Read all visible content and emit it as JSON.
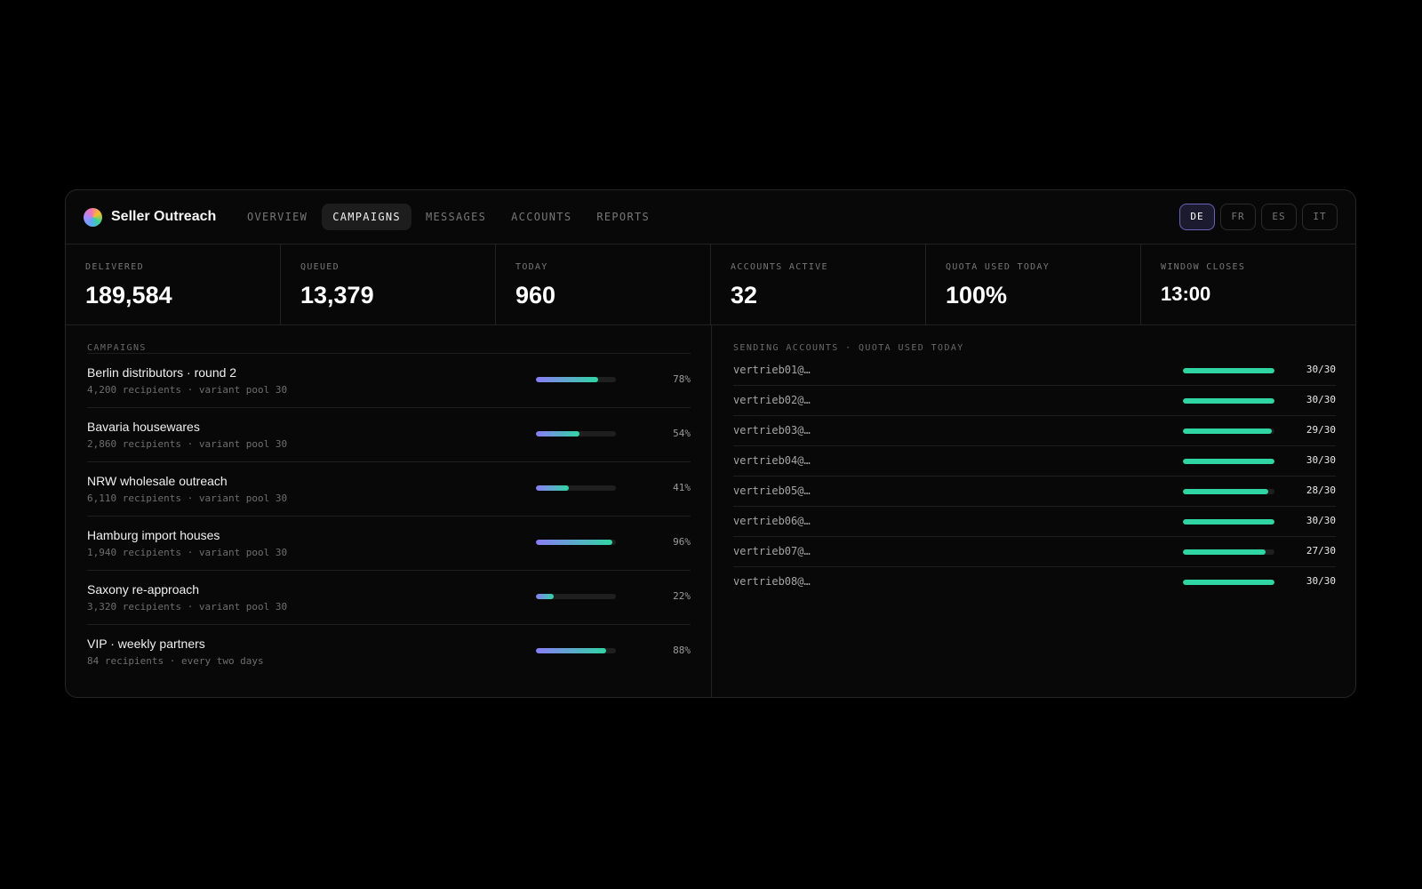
{
  "app": {
    "title": "Seller Outreach",
    "logo_icon": "gradient-circle-logo"
  },
  "nav": {
    "tabs": [
      {
        "label": "OVERVIEW",
        "active": false
      },
      {
        "label": "CAMPAIGNS",
        "active": true
      },
      {
        "label": "MESSAGES",
        "active": false
      },
      {
        "label": "ACCOUNTS",
        "active": false
      },
      {
        "label": "REPORTS",
        "active": false
      }
    ]
  },
  "languages": [
    {
      "code": "DE",
      "active": true
    },
    {
      "code": "FR",
      "active": false
    },
    {
      "code": "ES",
      "active": false
    },
    {
      "code": "IT",
      "active": false
    }
  ],
  "stats": [
    {
      "label": "DELIVERED",
      "value": "189,584"
    },
    {
      "label": "QUEUED",
      "value": "13,379"
    },
    {
      "label": "TODAY",
      "value": "960"
    },
    {
      "label": "ACCOUNTS ACTIVE",
      "value": "32"
    },
    {
      "label": "QUOTA USED TODAY",
      "value": "100%"
    },
    {
      "label": "WINDOW CLOSES",
      "value": "13:00"
    }
  ],
  "campaigns": {
    "title": "CAMPAIGNS",
    "items": [
      {
        "name": "Berlin distributors · round 2",
        "sub": "4,200 recipients · variant pool 30",
        "progress": 78,
        "pct_label": "78%"
      },
      {
        "name": "Bavaria housewares",
        "sub": "2,860 recipients · variant pool 30",
        "progress": 54,
        "pct_label": "54%"
      },
      {
        "name": "NRW wholesale outreach",
        "sub": "6,110 recipients · variant pool 30",
        "progress": 41,
        "pct_label": "41%"
      },
      {
        "name": "Hamburg import houses",
        "sub": "1,940 recipients · variant pool 30",
        "progress": 96,
        "pct_label": "96%"
      },
      {
        "name": "Saxony re-approach",
        "sub": "3,320 recipients · variant pool 30",
        "progress": 22,
        "pct_label": "22%"
      },
      {
        "name": "VIP · weekly partners",
        "sub": "84 recipients · every two days",
        "progress": 88,
        "pct_label": "88%"
      }
    ]
  },
  "accounts": {
    "title": "SENDING ACCOUNTS · QUOTA USED TODAY",
    "items": [
      {
        "name": "vertrieb01@…",
        "used": 30,
        "quota": 30,
        "label": "30/30"
      },
      {
        "name": "vertrieb02@…",
        "used": 30,
        "quota": 30,
        "label": "30/30"
      },
      {
        "name": "vertrieb03@…",
        "used": 29,
        "quota": 30,
        "label": "29/30"
      },
      {
        "name": "vertrieb04@…",
        "used": 30,
        "quota": 30,
        "label": "30/30"
      },
      {
        "name": "vertrieb05@…",
        "used": 28,
        "quota": 30,
        "label": "28/30"
      },
      {
        "name": "vertrieb06@…",
        "used": 30,
        "quota": 30,
        "label": "30/30"
      },
      {
        "name": "vertrieb07@…",
        "used": 27,
        "quota": 30,
        "label": "27/30"
      },
      {
        "name": "vertrieb08@…",
        "used": 30,
        "quota": 30,
        "label": "30/30"
      }
    ]
  },
  "colors": {
    "accent_purple": "#8b7cf6",
    "accent_green": "#2fd6a3",
    "active_lang_border": "#6a63b8"
  }
}
